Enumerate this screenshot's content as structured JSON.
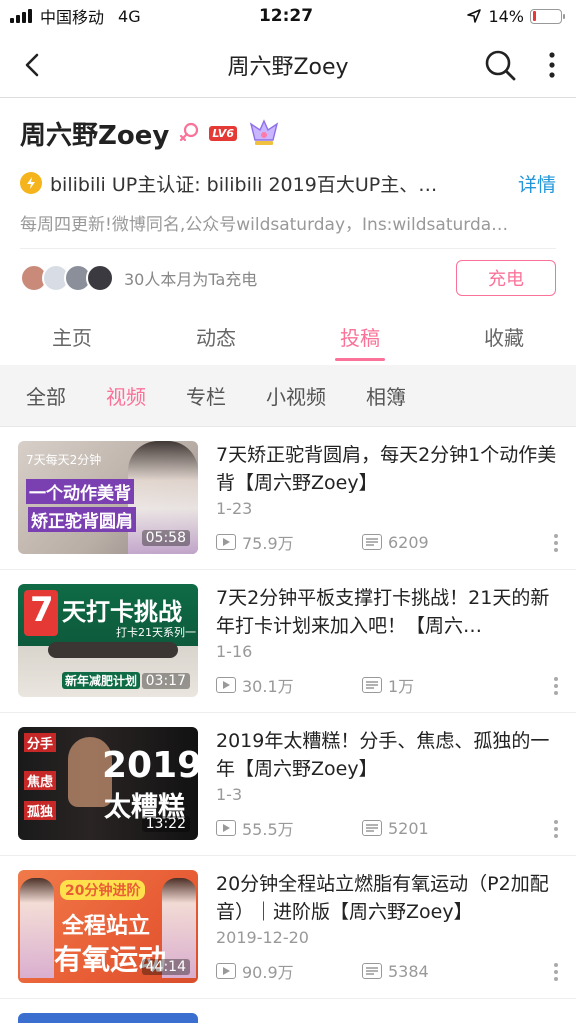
{
  "status_bar": {
    "carrier": "中国移动",
    "network": "4G",
    "time": "12:27",
    "battery": "14%",
    "battery_level": 0.14
  },
  "nav": {
    "title": "周六野Zoey"
  },
  "profile": {
    "name": "周六野Zoey",
    "level": "LV6",
    "certification": "bilibili UP主认证: bilibili 2019百大UP主、…",
    "detail_link": "详情",
    "signature": "每周四更新!微博同名,公众号wildsaturday，Ins:wildsaturda…",
    "charge_text": "30人本月为Ta充电",
    "charge_button": "充电"
  },
  "tabs": [
    "主页",
    "动态",
    "投稿",
    "收藏"
  ],
  "active_tab": "投稿",
  "subtabs": [
    "全部",
    "视频",
    "专栏",
    "小视频",
    "相簿"
  ],
  "active_subtab": "视频",
  "videos": [
    {
      "title": "7天矫正驼背圆肩，每天2分钟1个动作美背【周六野Zoey】",
      "date": "1-23",
      "plays": "75.9万",
      "danmaku": "6209",
      "duration": "05:58",
      "thumb_text": [
        "7天每天2分钟",
        "一个动作美背",
        "矫正驼背圆肩"
      ]
    },
    {
      "title": "7天2分钟平板支撑打卡挑战！21天的新年打卡计划来加入吧！【周六…",
      "date": "1-16",
      "plays": "30.1万",
      "danmaku": "1万",
      "duration": "03:17",
      "thumb_text": [
        "7",
        "天打卡挑战",
        "打卡21天系列一",
        "新年减肥计划"
      ]
    },
    {
      "title": "2019年太糟糕！分手、焦虑、孤独的一年【周六野Zoey】",
      "date": "1-3",
      "plays": "55.5万",
      "danmaku": "5201",
      "duration": "13:22",
      "thumb_text": [
        "分手",
        "焦虑",
        "孤独",
        "2019",
        "太糟糕"
      ]
    },
    {
      "title": "20分钟全程站立燃脂有氧运动（P2加配音）｜进阶版【周六野Zoey】",
      "date": "2019-12-20",
      "plays": "90.9万",
      "danmaku": "5384",
      "duration": "44:14",
      "thumb_text": [
        "20分钟进阶",
        "全程站立",
        "有氧运动"
      ]
    }
  ]
}
